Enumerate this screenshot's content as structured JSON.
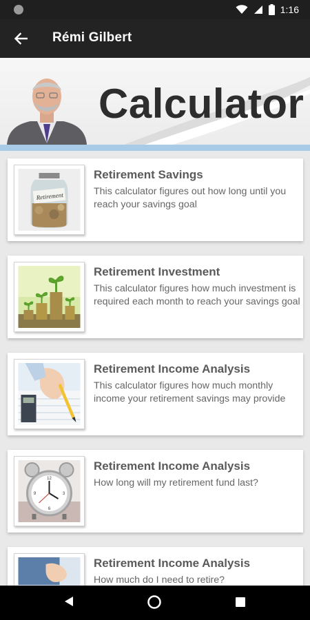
{
  "status_bar": {
    "time": "1:16",
    "icons": [
      "notification-dot-icon",
      "wifi-icon",
      "signal-icon",
      "battery-icon"
    ]
  },
  "app_bar": {
    "back_icon": "arrow-left-icon",
    "title": "Rémi Gilbert",
    "background": "#232323"
  },
  "banner": {
    "title": "Calculator",
    "accent_line_color": "#a8cce8"
  },
  "calculators": [
    {
      "title": "Retirement Savings",
      "description": "This calculator figures out how long until you reach your savings goal",
      "image": "coin-jar-retirement-image"
    },
    {
      "title": "Retirement Investment",
      "description": "This calculator figures how much investment is required each month to reach your savings goal",
      "image": "coin-stacks-plants-image"
    },
    {
      "title": "Retirement Income Analysis",
      "description": "This calculator figures how much monthly income your retirement savings may provide",
      "image": "hand-pencil-calculator-image"
    },
    {
      "title": "Retirement Income Analysis",
      "description": "How long will my retirement fund last?",
      "image": "alarm-clock-image"
    },
    {
      "title": "Retirement Income Analysis",
      "description": "How much do I need to retire?",
      "image": "hand-pen-image"
    }
  ],
  "nav_bar": {
    "buttons": [
      "back-triangle-icon",
      "home-circle-icon",
      "recents-square-icon"
    ]
  }
}
